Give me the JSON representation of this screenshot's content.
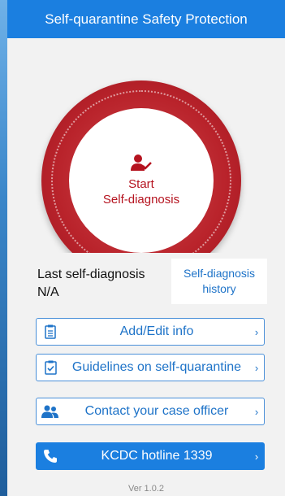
{
  "header": {
    "title": "Self-quarantine Safety Protection"
  },
  "hero": {
    "start_line1": "Start",
    "start_line2": "Self-diagnosis",
    "icon": "person-check-icon"
  },
  "status": {
    "label": "Last self-diagnosis",
    "value": "N/A"
  },
  "history": {
    "line1": "Self-diagnosis",
    "line2": "history"
  },
  "menu": [
    {
      "label": "Add/Edit info",
      "icon": "clipboard-icon"
    },
    {
      "label": "Guidelines on self-quarantine",
      "icon": "checklist-icon"
    },
    {
      "label": "Contact your case officer",
      "icon": "people-icon"
    },
    {
      "label": "KCDC hotline 1339",
      "icon": "phone-icon"
    }
  ],
  "chevron": "›",
  "footer": {
    "version": "Ver 1.0.2"
  },
  "colors": {
    "accent": "#1b7fe0",
    "ring": "#b9232b",
    "text_red": "#b5131f"
  }
}
